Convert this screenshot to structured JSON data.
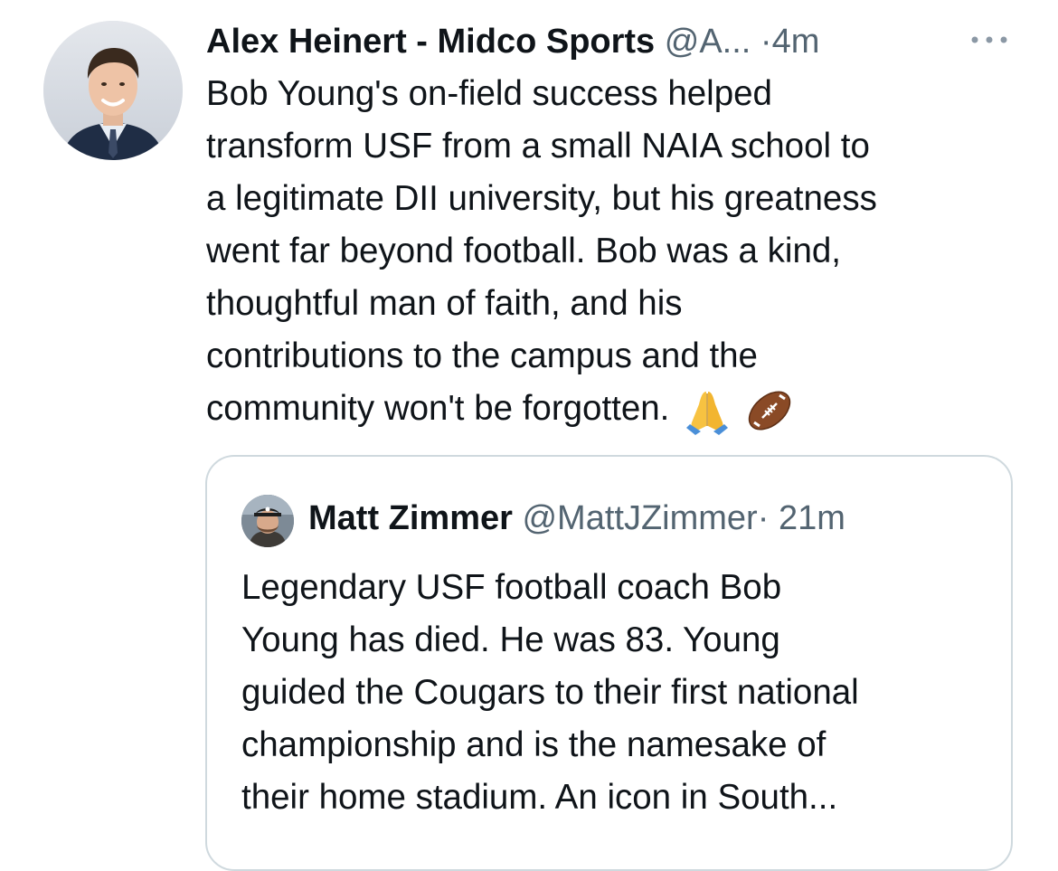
{
  "tweet": {
    "author": {
      "display_name": "Alex Heinert - Midco Sports",
      "handle": "@A...",
      "separator": "·",
      "time": "4m"
    },
    "more_icon": "more-horizontal-icon",
    "text_lines": [
      "Bob Young's on-field success helped",
      "transform USF from a small NAIA school to",
      "a legitimate DII university, but his greatness",
      "went far beyond football. Bob was a kind,",
      "thoughtful man of faith, and his",
      "contributions to the campus and the",
      "community won't be forgotten."
    ],
    "emojis": [
      "folded-hands-emoji",
      "american-football-emoji"
    ]
  },
  "quoted_tweet": {
    "author": {
      "display_name": "Matt Zimmer",
      "handle": "@MattJZimmer",
      "separator": "·",
      "time": "21m"
    },
    "text_lines": [
      "Legendary USF football coach Bob",
      "Young has died. He was 83. Young",
      "guided the Cougars to their first national",
      "championship and is the namesake of",
      "their home stadium. An icon in South..."
    ]
  },
  "colors": {
    "text_primary": "#0f1419",
    "text_secondary": "#536471",
    "border": "#cfd9de",
    "background": "#ffffff"
  }
}
